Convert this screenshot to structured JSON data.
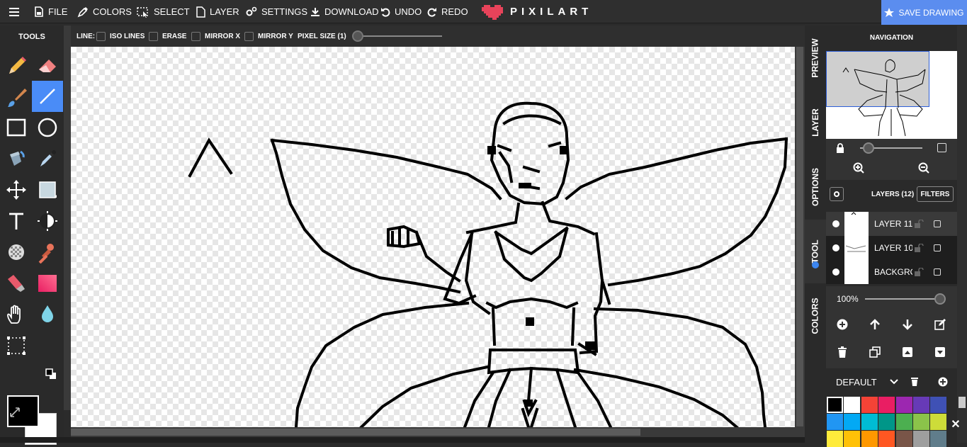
{
  "topbar": {
    "menu": [
      {
        "label": "FILE",
        "icon": "file-icon"
      },
      {
        "label": "COLORS",
        "icon": "eyedropper-icon"
      },
      {
        "label": "SELECT",
        "icon": "select-icon"
      },
      {
        "label": "LAYER",
        "icon": "page-icon"
      },
      {
        "label": "SETTINGS",
        "icon": "gears-icon"
      },
      {
        "label": "DOWNLOAD",
        "icon": "download-icon"
      },
      {
        "label": "UNDO",
        "icon": "undo-icon"
      },
      {
        "label": "REDO",
        "icon": "redo-icon"
      }
    ],
    "logo_text": "PIXILART",
    "logo_color": "#e8435a",
    "save_label": "SAVE DRAWING",
    "save_color": "#5b8def"
  },
  "tools": {
    "title": "TOOLS",
    "items": [
      "pencil",
      "eraser",
      "brush",
      "line",
      "rectangle",
      "circle",
      "bucket",
      "eyedropper",
      "move",
      "select-fill",
      "text",
      "lighten",
      "dither",
      "stamp",
      "clone",
      "gradient",
      "hand",
      "blur",
      "marquee"
    ],
    "active": "line",
    "primary_color": "#000000",
    "secondary_color": "#ffffff"
  },
  "options": {
    "line_label": "LINE:",
    "checkboxes": [
      "ISO LINES",
      "ERASE",
      "MIRROR X",
      "MIRROR Y"
    ],
    "pixel_size_label": "PIXEL SIZE (1)"
  },
  "side_tabs": [
    "PREVIEW",
    "LAYER",
    "OPTIONS",
    "TOOL",
    "COLORS"
  ],
  "active_side_tab": "TOOL",
  "navigation": {
    "title": "NAVIGATION"
  },
  "layers": {
    "title": "LAYERS (12)",
    "filters_label": "FILTERS",
    "rows": [
      {
        "name": "LAYER 11",
        "active": true
      },
      {
        "name": "LAYER 10",
        "active": false
      },
      {
        "name": "BACKGROUND",
        "active": false
      }
    ],
    "opacity_label": "100%",
    "opacity": 1.0
  },
  "palette": {
    "name": "DEFAULT",
    "colors": [
      "#000000",
      "#ffffff",
      "#f44336",
      "#e91e63",
      "#9c27b0",
      "#673ab7",
      "#3f51b5",
      "#2196f3",
      "#03a9f4",
      "#00bcd4",
      "#009688",
      "#4caf50",
      "#8bc34a",
      "#cddc39",
      "#ffeb3b",
      "#ffc107",
      "#ff9800",
      "#ff5722",
      "#795548",
      "#9e9e9e",
      "#607d8b"
    ]
  }
}
